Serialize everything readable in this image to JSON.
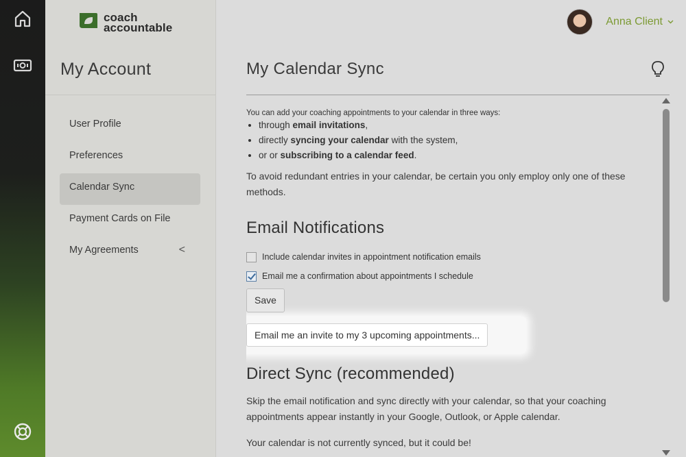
{
  "rail": {
    "icons": [
      "home-icon",
      "cash-icon",
      "help-lifebuoy-icon"
    ]
  },
  "brand": {
    "line1": "coach",
    "line2": "accountable",
    "color": "#3b6e2a"
  },
  "sidebar": {
    "title": "My Account",
    "items": [
      {
        "label": "User Profile",
        "active": false
      },
      {
        "label": "Preferences",
        "active": false
      },
      {
        "label": "Calendar Sync",
        "active": true
      },
      {
        "label": "Payment Cards on File",
        "active": false
      },
      {
        "label": "My Agreements",
        "active": false,
        "chevron": "<"
      }
    ]
  },
  "header": {
    "user_name": "Anna Client",
    "caret": "⌄",
    "accent": "#7c9a33"
  },
  "main": {
    "title": "My Calendar Sync",
    "intro": "You can add your coaching appointments to your calendar in three ways:",
    "ways": [
      {
        "pre": "through ",
        "bold": "email invitations",
        "post": ","
      },
      {
        "pre": "directly ",
        "bold": "syncing your calendar",
        "post": " with the system,"
      },
      {
        "pre": "or or ",
        "bold": "subscribing to a calendar feed",
        "post": "."
      }
    ],
    "warning": "To avoid redundant entries in your calendar, be certain you only employ only one of these methods.",
    "email_section": {
      "heading": "Email Notifications",
      "options": [
        {
          "label": "Include calendar invites in appointment notification emails",
          "checked": false
        },
        {
          "label": "Email me a confirmation about appointments I schedule",
          "checked": true
        }
      ],
      "save_label": "Save",
      "invite_label": "Email me an invite to my 3 upcoming appointments..."
    },
    "direct_section": {
      "heading": "Direct Sync (recommended)",
      "text": "Skip the email notification and sync directly with your calendar, so that your coaching appointments appear instantly in your Google, Outlook, or Apple calendar.",
      "status": "Your calendar is not currently synced, but it could be!"
    }
  }
}
